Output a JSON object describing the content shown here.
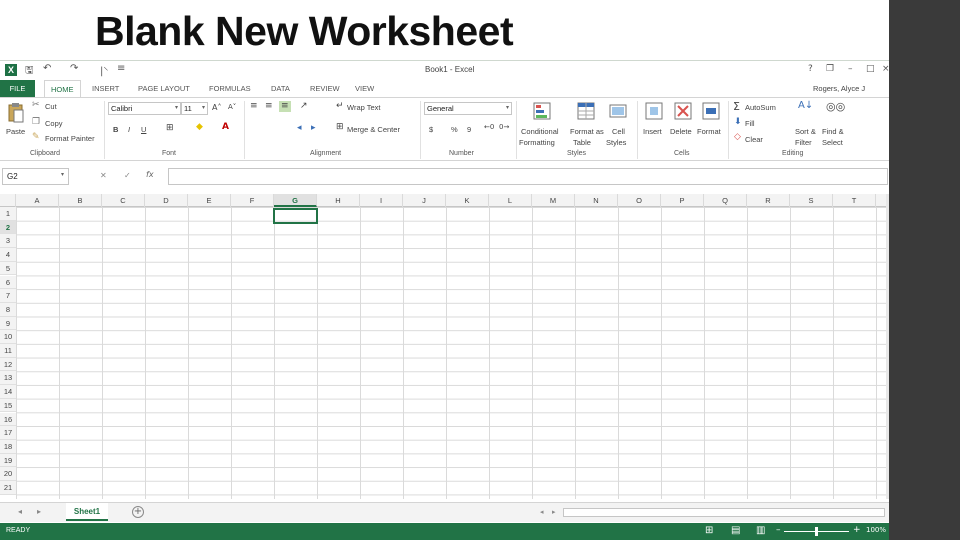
{
  "slide": {
    "title": "Blank New Worksheet"
  },
  "window": {
    "title": "Book1 - Excel",
    "app_icon": "X",
    "help": "?",
    "restore": "❐",
    "minimize": "–",
    "maximize": "□",
    "close": "×"
  },
  "qat": {
    "save": "H",
    "undo": "↶",
    "redo": "↷",
    "customize": "≡"
  },
  "tabs": {
    "file": "FILE",
    "home": "HOME",
    "insert": "INSERT",
    "page_layout": "PAGE LAYOUT",
    "formulas": "FORMULAS",
    "data": "DATA",
    "review": "REVIEW",
    "view": "VIEW"
  },
  "user": "Rogers, Alyce J",
  "clipboard": {
    "paste": "Paste",
    "cut": "Cut",
    "copy": "Copy",
    "format_painter": "Format Painter",
    "group": "Clipboard"
  },
  "font": {
    "name": "Calibri",
    "size": "11",
    "bold": "B",
    "italic": "I",
    "underline": "U",
    "group": "Font"
  },
  "alignment": {
    "wrap_text": "Wrap Text",
    "merge_center": "Merge & Center",
    "group": "Alignment"
  },
  "number": {
    "format": "General",
    "currency": "$",
    "percent": "%",
    "comma": "9",
    "group": "Number"
  },
  "styles": {
    "conditional": [
      "Conditional",
      "Formatting"
    ],
    "format_table": [
      "Format as",
      "Table"
    ],
    "cell_styles": [
      "Cell",
      "Styles"
    ],
    "group": "Styles"
  },
  "cells": {
    "insert": "Insert",
    "delete": "Delete",
    "format": "Format",
    "group": "Cells"
  },
  "editing": {
    "autosum": "AutoSum",
    "fill": "Fill",
    "clear": "Clear",
    "sort_filter": [
      "Sort &",
      "Filter"
    ],
    "find_select": [
      "Find &",
      "Select"
    ],
    "group": "Editing"
  },
  "formula_bar": {
    "name_box": "G2",
    "cancel": "✕",
    "enter": "✓",
    "fx": "fx",
    "value": ""
  },
  "columns": [
    "A",
    "B",
    "C",
    "D",
    "E",
    "F",
    "G",
    "H",
    "I",
    "J",
    "K",
    "L",
    "M",
    "N",
    "O",
    "P",
    "Q",
    "R",
    "S",
    "T"
  ],
  "rows": [
    "1",
    "2",
    "3",
    "4",
    "5",
    "6",
    "7",
    "8",
    "9",
    "10",
    "11",
    "12",
    "13",
    "14",
    "15",
    "16",
    "17",
    "18",
    "19",
    "20",
    "21"
  ],
  "selected": {
    "column": "G",
    "row": "2"
  },
  "sheets": {
    "tab": "Sheet1",
    "add": "+",
    "prev": "◂",
    "next": "▸"
  },
  "status": {
    "ready": "READY",
    "zoom_minus": "–",
    "zoom_plus": "+",
    "zoom": "100%"
  },
  "colors": {
    "excel_green": "#217346",
    "dark_bar": "#3a3a3a"
  }
}
